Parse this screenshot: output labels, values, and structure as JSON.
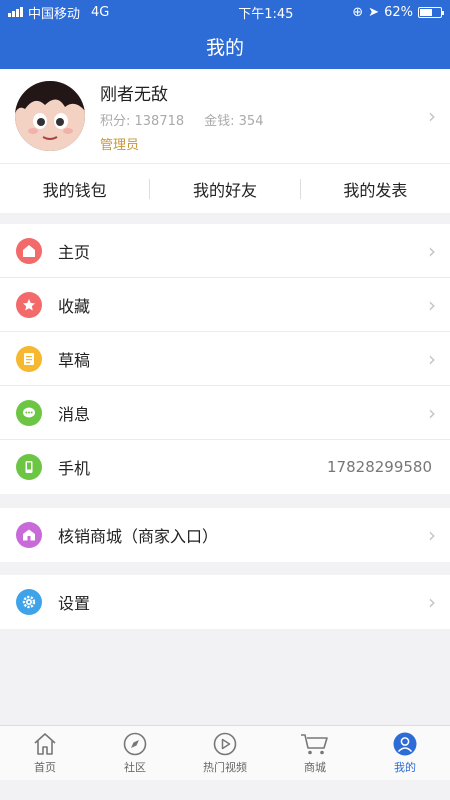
{
  "status_bar": {
    "carrier": "中国移动",
    "network": "4G",
    "time": "下午1:45",
    "battery": "62%",
    "battery_level": 0.62
  },
  "nav": {
    "title": "我的"
  },
  "profile": {
    "name": "刚者无敌",
    "points": "积分: 138718",
    "money": "金钱: 354",
    "role": "管理员"
  },
  "quick": [
    "我的钱包",
    "我的好友",
    "我的发表"
  ],
  "menu1": [
    {
      "label": "主页",
      "icon": "home-icon",
      "color": "#f26a6a",
      "value": ""
    },
    {
      "label": "收藏",
      "icon": "star-icon",
      "color": "#f26a6a",
      "value": ""
    },
    {
      "label": "草稿",
      "icon": "draft-icon",
      "color": "#f5b82e",
      "value": ""
    },
    {
      "label": "消息",
      "icon": "message-icon",
      "color": "#6cc644",
      "value": ""
    },
    {
      "label": "手机",
      "icon": "phone-icon",
      "color": "#6cc644",
      "value": "17828299580"
    }
  ],
  "menu2": [
    {
      "label": "核销商城（商家入口）",
      "icon": "shop-icon",
      "color": "#c86bd8"
    }
  ],
  "menu3": [
    {
      "label": "设置",
      "icon": "gear-icon",
      "color": "#3ea3e8"
    }
  ],
  "tabs": [
    {
      "label": "首页",
      "icon": "home-tab-icon",
      "active": false
    },
    {
      "label": "社区",
      "icon": "compass-icon",
      "active": false
    },
    {
      "label": "热门视频",
      "icon": "play-icon",
      "active": false
    },
    {
      "label": "商城",
      "icon": "cart-icon",
      "active": false
    },
    {
      "label": "我的",
      "icon": "user-icon",
      "active": true
    }
  ],
  "colors": {
    "primary": "#2d6bd6",
    "role": "#c8963a"
  }
}
